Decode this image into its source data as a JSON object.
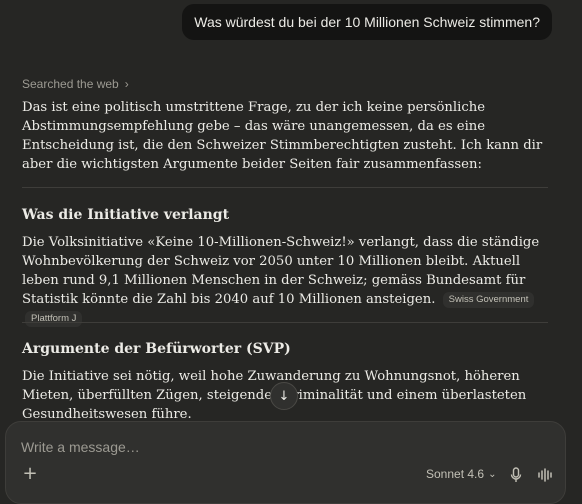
{
  "user_message": "Was würdest du bei der 10 Millionen Schweiz stimmen?",
  "searched_label": "Searched the web",
  "intro": "Das ist eine politisch umstrittene Frage, zu der ich keine persönliche Abstimmungsempfehlung gebe – das wäre unangemessen, da es eine Entscheidung ist, die den Schweizer Stimmberechtigten zusteht. Ich kann dir aber die wichtigsten Argumente beider Seiten fair zusammenfassen:",
  "section1": {
    "heading": "Was die Initiative verlangt",
    "text": "Die Volksinitiative «Keine 10-Millionen-Schweiz!» verlangt, dass die ständige Wohnbevölkerung der Schweiz vor 2050 unter 10 Millionen bleibt. Aktuell leben rund 9,1 Millionen Menschen in der Schweiz; gemäss Bundesamt für Statistik könnte die Zahl bis 2040 auf 10 Millionen ansteigen.",
    "sources": [
      "Swiss Government",
      "Plattform J"
    ]
  },
  "section2": {
    "heading": "Argumente der Befürworter (SVP)",
    "text": "Die Initiative sei nötig, weil hohe Zuwanderung zu Wohnungsnot, höheren Mieten, überfüllten Zügen, steigender Kriminalität und einem überlasteten Gesundheitswesen führe."
  },
  "composer": {
    "placeholder": "Write a message…",
    "model": "Sonnet 4.6"
  },
  "icons": {
    "searched_chevron": "chevron-right-icon",
    "scroll": "arrow-down-icon",
    "add": "plus-icon",
    "model_dropdown": "chevron-down-icon",
    "mic": "microphone-icon",
    "voice": "waveform-icon"
  }
}
